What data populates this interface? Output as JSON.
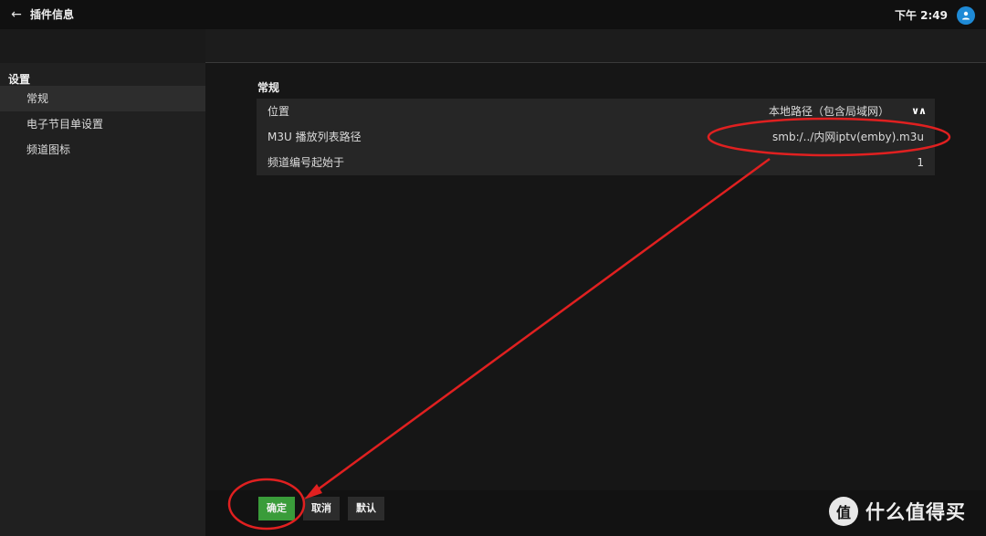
{
  "header": {
    "back_icon": "arrow-left-icon",
    "title": "插件信息",
    "time": "下午 2:49",
    "avatar_icon": "user-icon"
  },
  "sidebar": {
    "heading": "设置",
    "items": [
      {
        "label": "常规",
        "active": true
      },
      {
        "label": "电子节目单设置",
        "active": false
      },
      {
        "label": "频道图标",
        "active": false
      }
    ]
  },
  "main": {
    "section_title": "常规",
    "settings": [
      {
        "label": "位置",
        "value": "本地路径（包含局域网）",
        "icon": "chevron-up-down-icon"
      },
      {
        "label": "M3U 播放列表路径",
        "value": "smb:/../内网iptv(emby).m3u"
      },
      {
        "label": "频道编号起始于",
        "value": "1"
      }
    ]
  },
  "footer": {
    "ok_label": "确定",
    "cancel_label": "取消",
    "default_label": "默认"
  },
  "annotation": {
    "color": "#e02020"
  },
  "watermark": {
    "logo_text": "值",
    "text": "什么值得买"
  },
  "colors": {
    "accent": "#1e8ad6",
    "primary_button": "#3a9c3a"
  }
}
